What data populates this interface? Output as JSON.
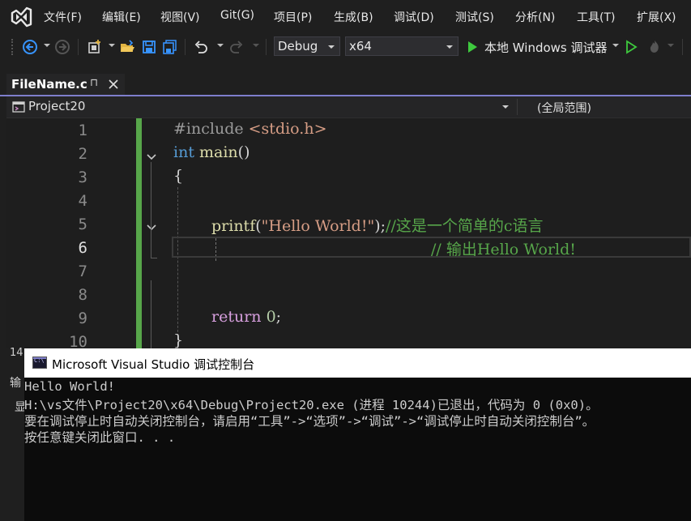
{
  "menubar": {
    "items": [
      "文件(F)",
      "编辑(E)",
      "视图(V)",
      "Git(G)",
      "项目(P)",
      "生成(B)",
      "调试(D)",
      "测试(S)",
      "分析(N)",
      "工具(T)",
      "扩展(X)"
    ]
  },
  "toolbar": {
    "configuration": "Debug",
    "platform": "x64",
    "run_label": "本地 Windows 调试器"
  },
  "tab": {
    "filename": "FileName.c",
    "pin_glyph": "⊓"
  },
  "navbar": {
    "project": "Project20",
    "scope": "(全局范围)"
  },
  "editor": {
    "line_numbers": [
      "1",
      "2",
      "3",
      "4",
      "5",
      "6",
      "7",
      "8",
      "9",
      "10"
    ],
    "lines": {
      "l1_pre": "#include ",
      "l1_hdr": "<stdio.h>",
      "l2_kw": "int",
      "l2_fn": "main",
      "l2_rest": "()",
      "l3": "{",
      "l5_fn": "printf",
      "l5_p1": "(",
      "l5_str": "\"Hello World!\"",
      "l5_p2": ");",
      "l5_cmt": "//这是一个简单的c语言",
      "l6_cmt": "// 输出Hello World!",
      "l9_kw": "return",
      "l9_num": "0",
      "l9_rest": ";",
      "l10": "}"
    }
  },
  "bottom_panel": {
    "zoom_partial": "14",
    "output_partial": "输",
    "show_partial": "显"
  },
  "console": {
    "title": "Microsoft Visual Studio 调试控制台",
    "icon_label": "C:\\",
    "lines": [
      "Hello World!",
      "H:\\vs文件\\Project20\\x64\\Debug\\Project20.exe (进程 10244)已退出，代码为 0 (0x0)。",
      "要在调试停止时自动关闭控制台，请启用“工具”->“选项”->“调试”->“调试停止时自动关闭控制台”。",
      "按任意键关闭此窗口. . ."
    ]
  },
  "colors": {
    "accent": "#7e7ecc",
    "change_bar": "#57a64a",
    "background": "#1f1f1f",
    "console_bg": "#0c0c0c"
  }
}
